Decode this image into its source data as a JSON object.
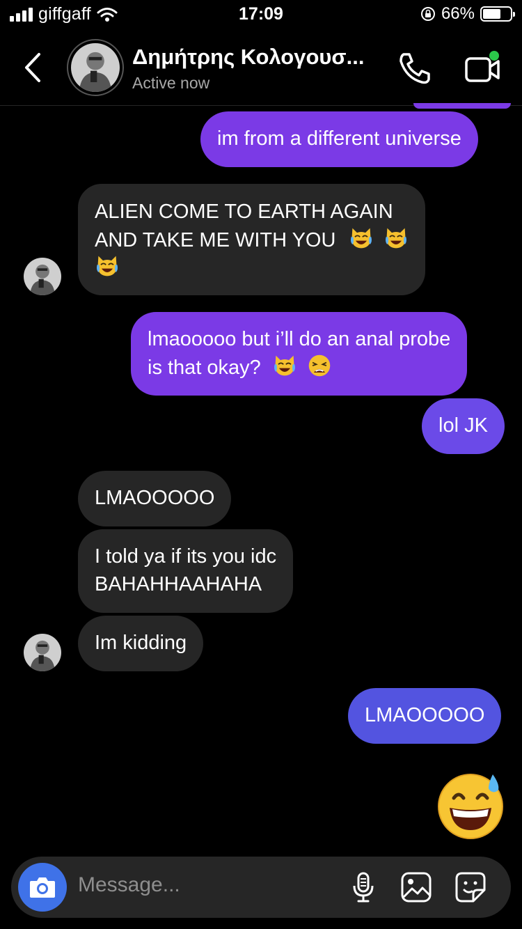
{
  "status_bar": {
    "carrier": "giffgaff",
    "time": "17:09",
    "battery": "66%",
    "battery_level": 0.66
  },
  "header": {
    "contact_name": "Δημήτρης Κολογουσ...",
    "contact_status": "Active now",
    "online_dot_color": "#2bc84a"
  },
  "messages": [
    {
      "from": "me",
      "text": "im from a different universe"
    },
    {
      "from": "them",
      "line1": "ALIEN COME TO EARTH AGAIN",
      "line2": "AND TAKE ME WITH YOU"
    },
    {
      "from": "me",
      "line1": "lmaooooo but i’ll do an anal probe",
      "line2": "is that okay?"
    },
    {
      "from": "me",
      "text": "lol JK"
    },
    {
      "from": "them",
      "text": "LMAOOOOO"
    },
    {
      "from": "them",
      "line1": "I told ya if its you idc",
      "line2": "BAHAHHAAHAHA"
    },
    {
      "from": "them",
      "text": "Im kidding"
    },
    {
      "from": "me",
      "text": "LMAOOOOO"
    },
    {
      "from": "me",
      "emoji": "grinning-sweat-emoji"
    }
  ],
  "composer": {
    "placeholder": "Message..."
  },
  "colors": {
    "bubble_incoming": "#262626",
    "bubble_out_purple": "#7b3ae6",
    "bubble_out_violet": "#6b4ae8",
    "bubble_out_blue": "#5354e0",
    "camera_button": "#3f72e8"
  }
}
